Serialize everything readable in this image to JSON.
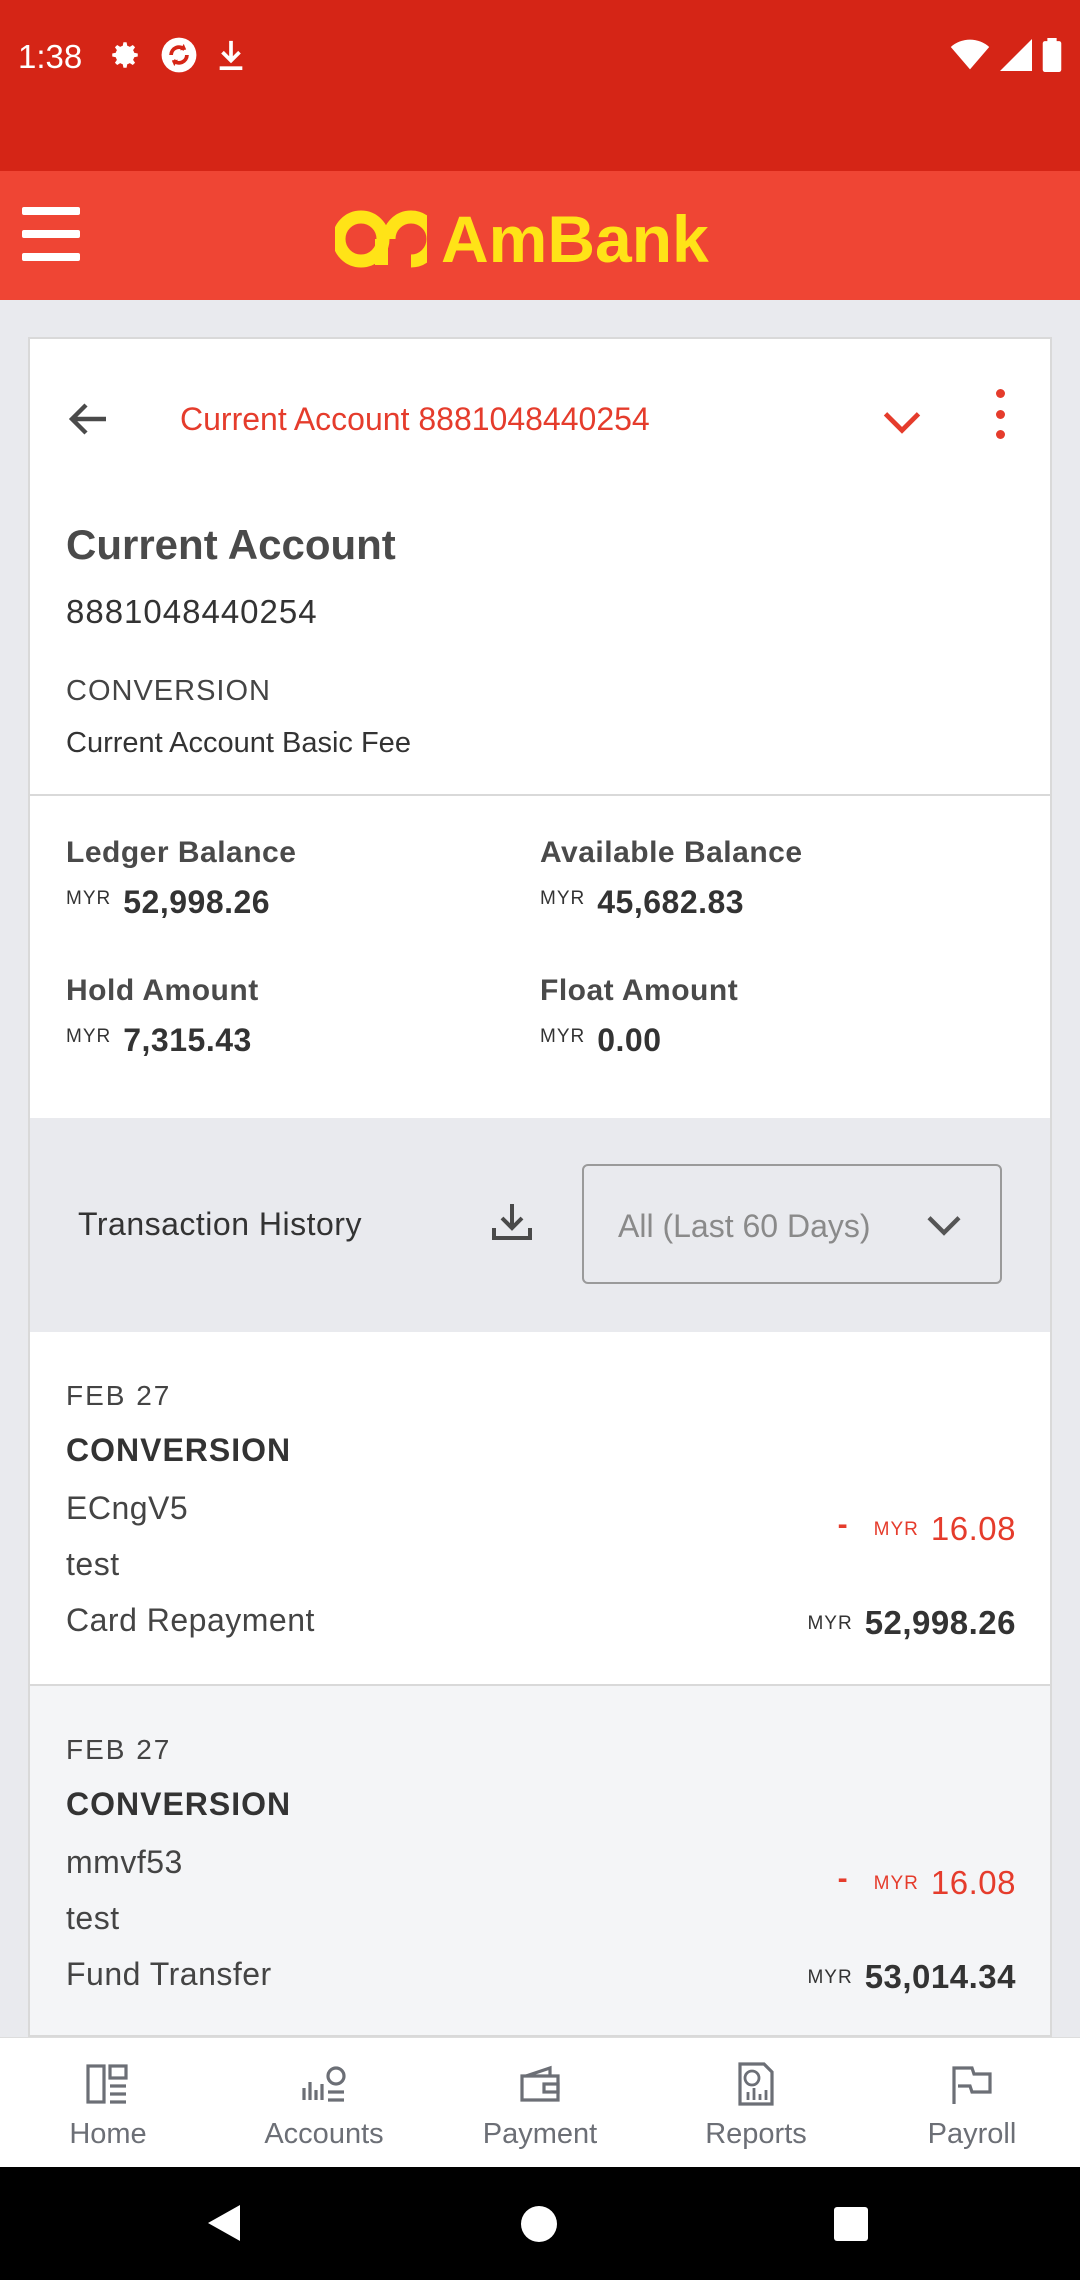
{
  "status_bar": {
    "time": "1:38"
  },
  "header": {
    "logo_text": "AmBank",
    "brand_color": "#ffe317"
  },
  "account": {
    "selector_label": "Current Account 8881048440254",
    "name": "Current Account",
    "number": "8881048440254",
    "desc1": "CONVERSION",
    "desc2": "Current Account Basic Fee"
  },
  "balances": {
    "ledger_label": "Ledger Balance",
    "ledger_currency": "MYR",
    "ledger_amount": "52,998.26",
    "available_label": "Available Balance",
    "available_currency": "MYR",
    "available_amount": "45,682.83",
    "hold_label": "Hold Amount",
    "hold_currency": "MYR",
    "hold_amount": "7,315.43",
    "float_label": "Float Amount",
    "float_currency": "MYR",
    "float_amount": "0.00"
  },
  "transactions": {
    "title": "Transaction History",
    "filter": "All (Last 60 Days)",
    "items": [
      {
        "date": "FEB 27",
        "type": "CONVERSION",
        "line1": "ECngV5",
        "line2": "test",
        "line3": "Card Repayment",
        "sign": "-",
        "amount_currency": "MYR",
        "amount": "16.08",
        "balance_currency": "MYR",
        "balance": "52,998.26"
      },
      {
        "date": "FEB 27",
        "type": "CONVERSION",
        "line1": "mmvf53",
        "line2": "test",
        "line3": "Fund Transfer",
        "sign": "-",
        "amount_currency": "MYR",
        "amount": "16.08",
        "balance_currency": "MYR",
        "balance": "53,014.34"
      }
    ]
  },
  "bottom_nav": {
    "items": [
      {
        "label": "Home",
        "icon": "home-icon"
      },
      {
        "label": "Accounts",
        "icon": "accounts-icon"
      },
      {
        "label": "Payment",
        "icon": "wallet-icon"
      },
      {
        "label": "Reports",
        "icon": "reports-icon"
      },
      {
        "label": "Payroll",
        "icon": "payroll-icon"
      }
    ]
  },
  "colors": {
    "status_bar": "#d52516",
    "header": "#ef4534",
    "accent": "#e53c2c"
  }
}
